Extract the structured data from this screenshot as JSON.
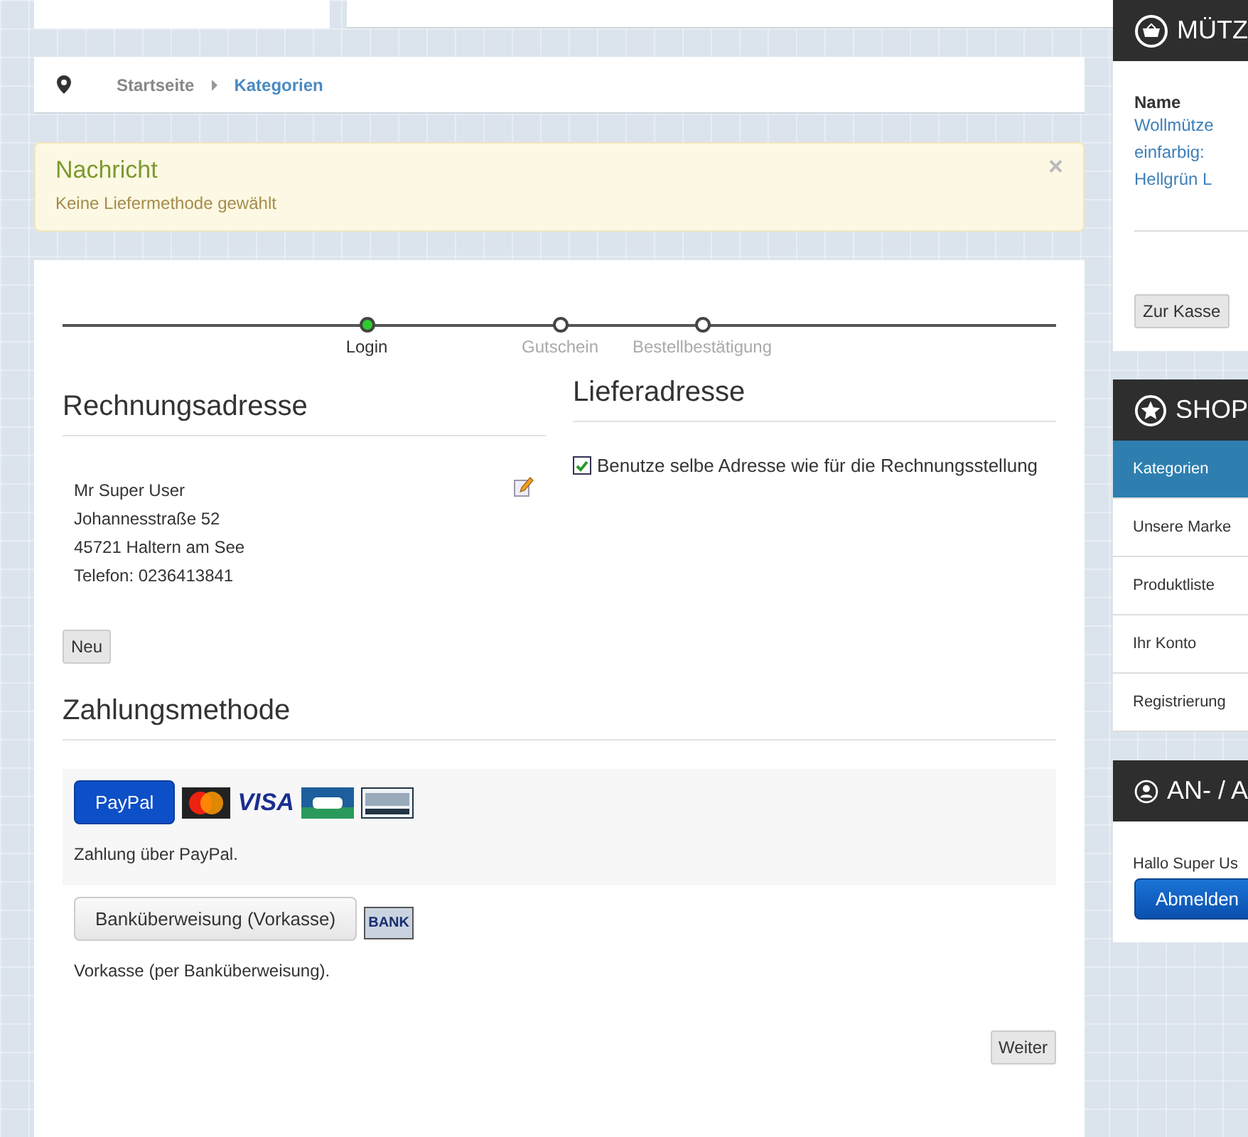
{
  "breadcrumb": [
    {
      "label": "Startseite",
      "selected": false
    },
    {
      "label": "Kategorien",
      "selected": true
    }
  ],
  "message": {
    "title": "Nachricht",
    "text": "Keine Liefermethode gewählt",
    "close": "×"
  },
  "steps": [
    {
      "label": "Login",
      "selected": true
    },
    {
      "label": "Gutschein",
      "selected": false
    },
    {
      "label": "Bestellbestätigung",
      "selected": false
    }
  ],
  "billing": {
    "title": "Rechnungsadresse",
    "lines": [
      "Mr Super User",
      "Johannesstraße 52",
      "45721 Haltern am See",
      "Telefon: 0236413841"
    ],
    "new_button": "Neu"
  },
  "shipping": {
    "title": "Lieferadresse",
    "same_address": {
      "label": "Benutze selbe Adresse wie für die Rechnungsstellung",
      "checked": true
    }
  },
  "payment": {
    "title": "Zahlungsmethode",
    "methods": [
      {
        "kind": "paypal",
        "button": "PayPal",
        "selected": true,
        "logo_text": "VISA",
        "description": "Zahlung über PayPal."
      },
      {
        "kind": "bank",
        "button": "Banküberweisung (Vorkasse)",
        "selected": false,
        "logo_text": "BANK",
        "description": "Vorkasse (per Banküberweisung)."
      }
    ]
  },
  "next_button": "Weiter",
  "sidebar": {
    "cart": {
      "title": "MÜTZ",
      "column": "Name",
      "item": "Wollmütze einfarbig: Hellgrün L",
      "checkout": "Zur Kasse"
    },
    "shop": {
      "title": "SHOP",
      "items": [
        {
          "label": "Kategorien",
          "selected": true
        },
        {
          "label": "Unsere Marke",
          "selected": false
        },
        {
          "label": "Produktliste",
          "selected": false
        },
        {
          "label": "Ihr Konto",
          "selected": false
        },
        {
          "label": "Registrierung",
          "selected": false
        }
      ]
    },
    "account": {
      "title": "AN- / A",
      "greeting": "Hallo Super Us",
      "logout": "Abmelden"
    }
  }
}
